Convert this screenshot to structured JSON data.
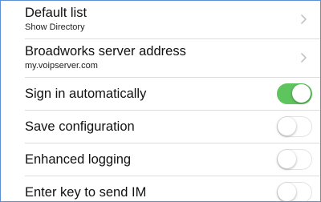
{
  "colors": {
    "frame_border": "#5b8fd6",
    "toggle_on": "#5ec55e",
    "separator": "#dcdcdc"
  },
  "settings": {
    "default_list": {
      "title": "Default list",
      "subtitle": "Show Directory",
      "icon": "chevron-right-icon"
    },
    "broadworks_server": {
      "title": "Broadworks server address",
      "subtitle": "my.voipserver.com",
      "icon": "chevron-right-icon"
    },
    "sign_in_automatically": {
      "title": "Sign in automatically",
      "enabled": true
    },
    "save_configuration": {
      "title": "Save configuration",
      "enabled": false
    },
    "enhanced_logging": {
      "title": "Enhanced logging",
      "enabled": false
    },
    "enter_key_send_im": {
      "title": "Enter key to send IM",
      "enabled": false
    }
  }
}
